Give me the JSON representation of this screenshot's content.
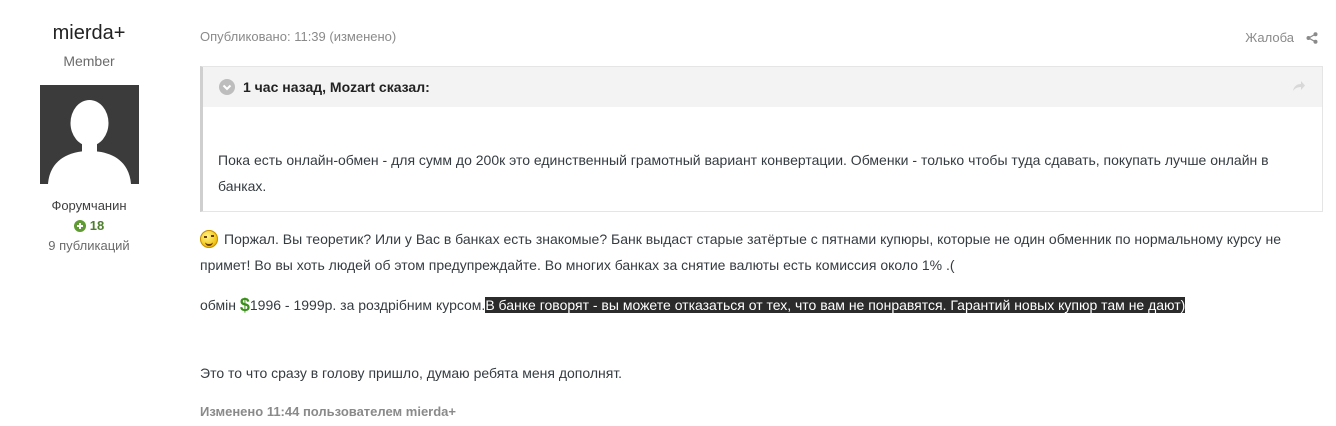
{
  "author": {
    "name": "mierda+",
    "group": "Member",
    "rank": "Форумчанин",
    "reputation": "18",
    "posts": "9 публикаций"
  },
  "post": {
    "meta": "Опубликовано: 11:39 (изменено)",
    "report_label": "Жалоба",
    "quote": {
      "citation": "1 час назад, Mozart сказал:",
      "text": "Пока есть онлайн-обмен - для сумм до 200к это единственный грамотный вариант конвертации. Обменки - только чтобы туда сдавать, покупать лучше онлайн в банках."
    },
    "paragraph1": "Поржал. Вы теоретик? Или у Вас в банках есть знакомые? Банк выдаст старые затёртые с пятнами купюры, которые не один обменник по нормальному курсу не примет! Во вы хоть людей об этом предупреждайте. Во многих банках за снятие валюты есть комиссия около 1% .(",
    "paragraph2_prefix": "обмін ",
    "paragraph2_dollar": "$",
    "paragraph2_middle": "1996 - 1999р. за роздрібним курсом.",
    "paragraph2_highlight": "В банке говорят - вы можете отказаться от тех, что вам не понравятся. Гарантий новых купюр там не дают)",
    "paragraph3": "Это то что сразу в голову пришло, думаю ребята меня дополнят.",
    "edited": "Изменено 11:44 пользователем mierda+"
  },
  "icons": {
    "quote_toggle": "chevron-down-icon",
    "quote_jump": "share-arrow-icon",
    "share": "share-icon",
    "reputation": "plus-circle-icon",
    "emoji": "smiley-icon"
  },
  "colors": {
    "reputation": "#4e7e2e",
    "highlight_bg": "#2b2b2b",
    "quote_header_bg": "#f3f3f3"
  }
}
